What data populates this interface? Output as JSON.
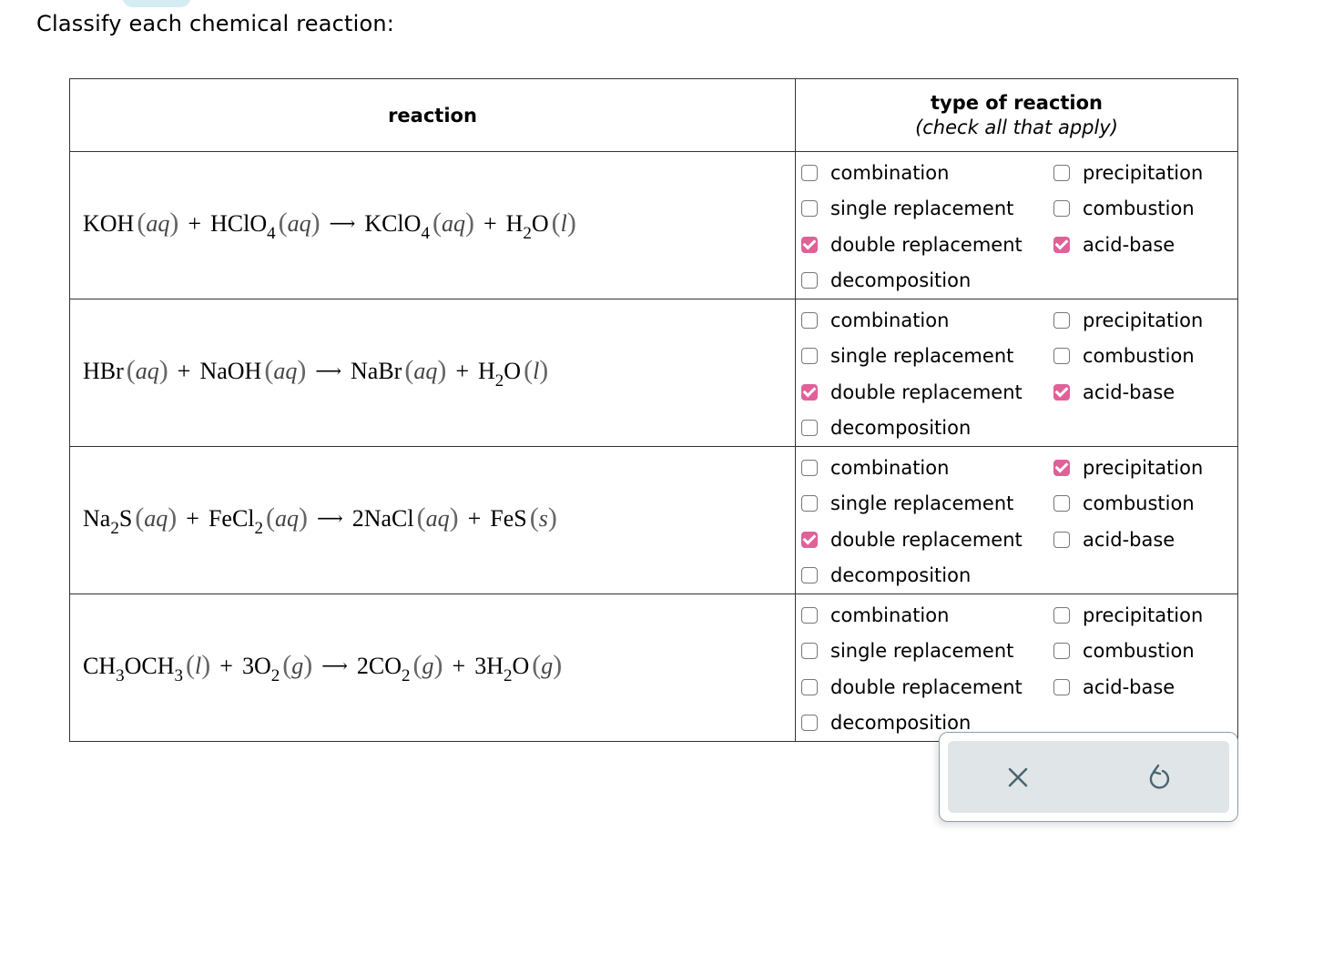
{
  "prompt": "Classify each chemical reaction:",
  "table": {
    "header_reaction": "reaction",
    "header_type": "type of reaction",
    "header_type_sub": "(check all that apply)"
  },
  "reactions": [
    {
      "equation_text": "KOH(aq) + HClO4(aq) → KClO4(aq) + H2O(l)",
      "lhs": [
        {
          "pre": "KOH",
          "sub": "",
          "post": "",
          "state": "aq"
        },
        {
          "pre": "HClO",
          "sub": "4",
          "post": "",
          "state": "aq"
        }
      ],
      "rhs": [
        {
          "pre": "KClO",
          "sub": "4",
          "post": "",
          "state": "aq"
        },
        {
          "pre": "H",
          "sub": "2",
          "post": "O",
          "state": "l"
        }
      ],
      "options": {
        "combination": false,
        "single replacement": false,
        "double replacement": true,
        "decomposition": false,
        "precipitation": false,
        "combustion": false,
        "acid-base": true
      }
    },
    {
      "equation_text": "HBr(aq) + NaOH(aq) → NaBr(aq) + H2O(l)",
      "options": {
        "combination": false,
        "single replacement": false,
        "double replacement": true,
        "decomposition": false,
        "precipitation": false,
        "combustion": false,
        "acid-base": true
      }
    },
    {
      "equation_text": "Na2S(aq) + FeCl2(aq) → 2NaCl(aq) + FeS(s)",
      "options": {
        "combination": false,
        "single replacement": false,
        "double replacement": true,
        "decomposition": false,
        "precipitation": true,
        "combustion": false,
        "acid-base": false
      }
    },
    {
      "equation_text": "CH3OCH3(l) + 3O2(g) → 2CO2(g) + 3H2O(g)",
      "options": {
        "combination": false,
        "single replacement": false,
        "double replacement": false,
        "decomposition": false,
        "precipitation": false,
        "combustion": false,
        "acid-base": false
      }
    }
  ],
  "option_labels": {
    "left": [
      "combination",
      "single replacement",
      "double replacement",
      "decomposition"
    ],
    "right": [
      "precipitation",
      "combustion",
      "acid-base"
    ]
  },
  "equations_markup": [
    [
      [
        "KOH",
        ""
      ],
      [
        "aq"
      ],
      "+",
      [
        "HClO",
        "4"
      ],
      [
        "aq"
      ],
      "→",
      [
        "KClO",
        "4"
      ],
      [
        "aq"
      ],
      "+",
      [
        "H",
        "2",
        "O"
      ],
      [
        "l"
      ]
    ],
    [
      [
        "HBr",
        ""
      ],
      [
        "aq"
      ],
      "+",
      [
        "NaOH",
        ""
      ],
      [
        "aq"
      ],
      "→",
      [
        "NaBr",
        ""
      ],
      [
        "aq"
      ],
      "+",
      [
        "H",
        "2",
        "O"
      ],
      [
        "l"
      ]
    ],
    [
      [
        "Na",
        "2",
        "S"
      ],
      [
        "aq"
      ],
      "+",
      [
        "FeCl",
        "2"
      ],
      [
        "aq"
      ],
      "→",
      [
        "2NaCl",
        ""
      ],
      [
        "aq"
      ],
      "+",
      [
        "FeS",
        ""
      ],
      [
        "s"
      ]
    ],
    [
      [
        "CH",
        "3",
        "OCH",
        "3"
      ],
      [
        "l"
      ],
      "+",
      [
        "3O",
        "2"
      ],
      [
        "g"
      ],
      "→",
      [
        "2CO",
        "2"
      ],
      [
        "g"
      ],
      "+",
      [
        "3H",
        "2",
        "O"
      ],
      [
        "g"
      ]
    ]
  ],
  "actions": {
    "clear_icon": "close-icon",
    "reset_icon": "undo-icon",
    "clear_glyph": "✕",
    "reset_glyph": "↺"
  },
  "colors": {
    "checked": "#e0609a",
    "action_bg": "#e0e5e8",
    "action_icon": "#4a6572",
    "tab": "#d5ecf2"
  }
}
